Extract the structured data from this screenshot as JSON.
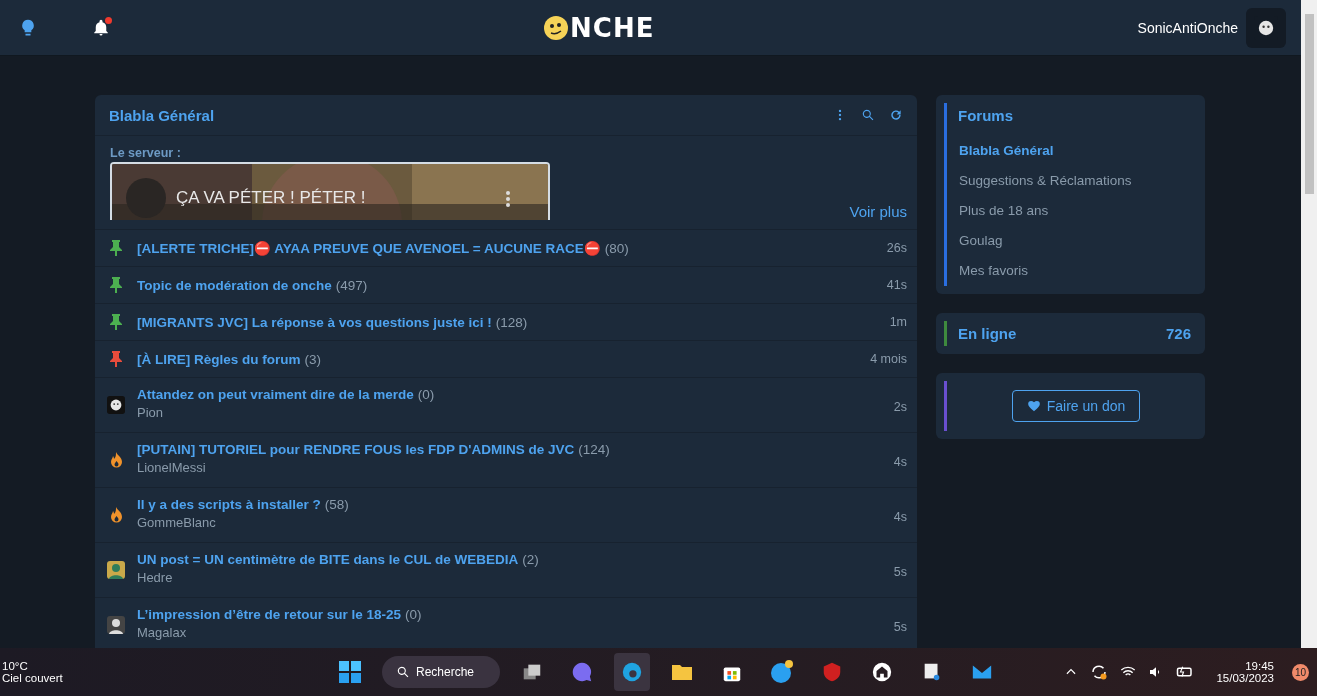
{
  "header": {
    "logo_text": "NCHE",
    "username": "SonicAntiOnche",
    "notification_dot": true
  },
  "forum": {
    "title": "Blabla Général",
    "server_label": "Le serveur :",
    "video_title": "ÇA VA PÉTER ! PÉTER !",
    "more_link": "Voir plus",
    "topics": [
      {
        "kind": "pin",
        "color": "#4caf50",
        "title": "[ALERTE TRICHE]⛔ AYAA PREUVE QUE AVENOEL = AUCUNE RACE⛔",
        "count": "(80)",
        "time": "26s"
      },
      {
        "kind": "pin",
        "color": "#4caf50",
        "title": "Topic de modération de onche",
        "count": "(497)",
        "time": "41s"
      },
      {
        "kind": "pin",
        "color": "#4caf50",
        "title": "[MIGRANTS JVC] La réponse à vos questions juste ici !",
        "count": "(128)",
        "time": "1m"
      },
      {
        "kind": "pin",
        "color": "#e74c3c",
        "title": "[À LIRE] Règles du forum",
        "count": "(3)",
        "time": "4 mois"
      },
      {
        "kind": "avatar",
        "title": "Attandez on peut vraiment dire de la merde",
        "count": "(0)",
        "author": "Pion",
        "time": "2s"
      },
      {
        "kind": "hot",
        "title": "[PUTAIN] TUTORIEL pour RENDRE FOUS les FDP D'ADMINS de JVC",
        "count": "(124)",
        "author": "LionelMessi",
        "time": "4s"
      },
      {
        "kind": "hot",
        "title": "Il y a des scripts à installer ?",
        "count": "(58)",
        "author": "GommeBlanc",
        "time": "4s"
      },
      {
        "kind": "avatar",
        "title": "UN post = UN centimètre de BITE dans le CUL de WEBEDIA",
        "count": "(2)",
        "author": "Hedre",
        "time": "5s"
      },
      {
        "kind": "avatar",
        "title": "L’impression d’être de retour sur le 18-25",
        "count": "(0)",
        "author": "Magalax",
        "time": "5s"
      }
    ]
  },
  "sidebar": {
    "forums_title": "Forums",
    "forums": [
      {
        "label": "Blabla Général",
        "selected": true
      },
      {
        "label": "Suggestions & Réclamations",
        "selected": false
      },
      {
        "label": "Plus de 18 ans",
        "selected": false
      },
      {
        "label": "Goulag",
        "selected": false
      },
      {
        "label": "Mes favoris",
        "selected": false
      }
    ],
    "online_label": "En ligne",
    "online_count": "726",
    "donate_button": "Faire un don"
  },
  "taskbar": {
    "temperature": "10°C",
    "weather": "Ciel couvert",
    "search": "Recherche",
    "time": "19:45",
    "date": "15/03/2023",
    "notifications": "10"
  }
}
